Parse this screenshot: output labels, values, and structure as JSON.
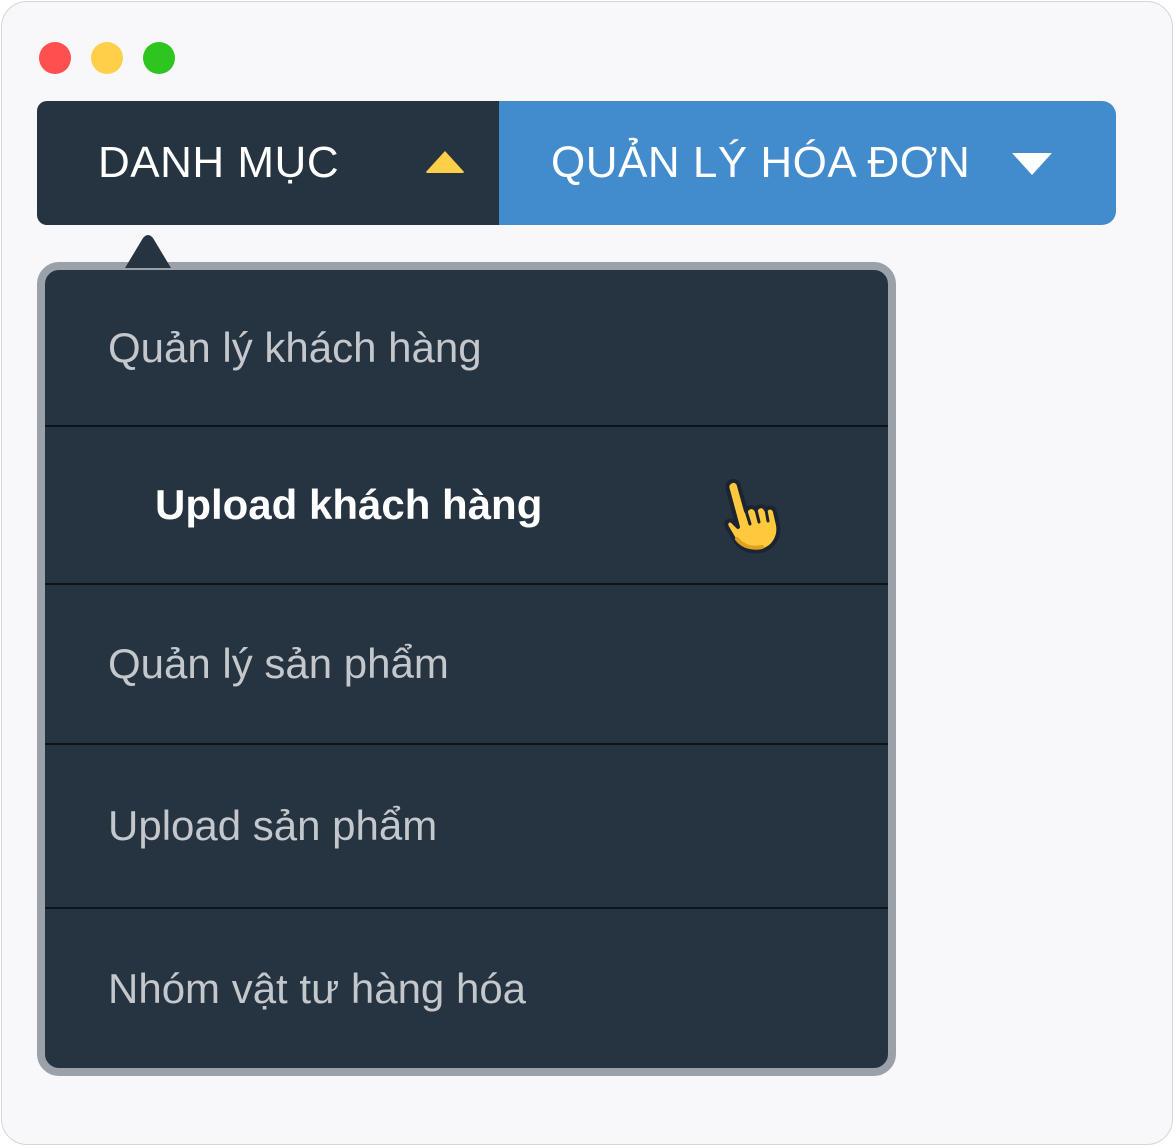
{
  "window": {
    "controls": [
      "close",
      "minimize",
      "maximize"
    ]
  },
  "nav": {
    "categories_label": "DANH MỤC",
    "categories_icon": "caret-up-icon",
    "invoices_label": "QUẢN LÝ HÓA ĐƠN",
    "invoices_icon": "caret-down-icon"
  },
  "dropdown": {
    "items": [
      {
        "label": "Quản lý khách hàng"
      },
      {
        "label": "Upload khách hàng",
        "active": true
      },
      {
        "label": "Quản lý sản phẩm"
      },
      {
        "label": "Upload sản phẩm"
      },
      {
        "label": "Nhóm vật tư hàng hóa"
      }
    ],
    "cursor_icon": "pointing-hand-icon"
  },
  "colors": {
    "window_bg": "#f8f8fa",
    "dark": "#263340",
    "blue": "#428bcc",
    "accent_yellow": "#ffcf4a",
    "dropdown_border": "#9aa1a8"
  }
}
